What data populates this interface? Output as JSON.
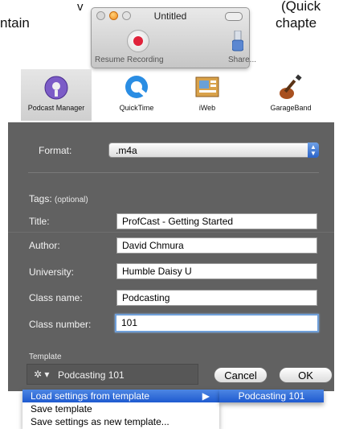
{
  "background_text": {
    "left_top": "v",
    "left_bottom": "ntain",
    "right_top": "(Quick",
    "right_bottom": "chapte"
  },
  "mini_window": {
    "title": "Untitled",
    "resume_label": "Resume Recording",
    "share_label": "Share..."
  },
  "apps": [
    {
      "label": "Podcast Manager",
      "icon": "podcast-manager-icon"
    },
    {
      "label": "QuickTime",
      "icon": "quicktime-icon"
    },
    {
      "label": "iWeb",
      "icon": "iweb-icon"
    },
    {
      "label": "GarageBand",
      "icon": "garageband-icon"
    }
  ],
  "form": {
    "format_label": "Format:",
    "format_value": ".m4a",
    "tags_label": "Tags:",
    "tags_optional": "(optional)",
    "fields": [
      {
        "label": "Title:",
        "value": "ProfCast - Getting Started"
      },
      {
        "label": "Author:",
        "value": "David Chmura"
      },
      {
        "label": "University:",
        "value": "Humble Daisy U"
      },
      {
        "label": "Class name:",
        "value": "Podcasting"
      },
      {
        "label": "Class number:",
        "value": "101"
      }
    ]
  },
  "template": {
    "label": "Template",
    "current": "Podcasting 101",
    "gear_icon": "gear-icon"
  },
  "buttons": {
    "cancel": "Cancel",
    "ok": "OK"
  },
  "menu": {
    "items": [
      "Load settings from template",
      "Save template",
      "Save settings as new template..."
    ],
    "submenu_item": "Podcasting 101"
  },
  "colors": {
    "panel_bg": "#616161",
    "highlight": "#2b63d4",
    "record_red": "#e0223a"
  }
}
